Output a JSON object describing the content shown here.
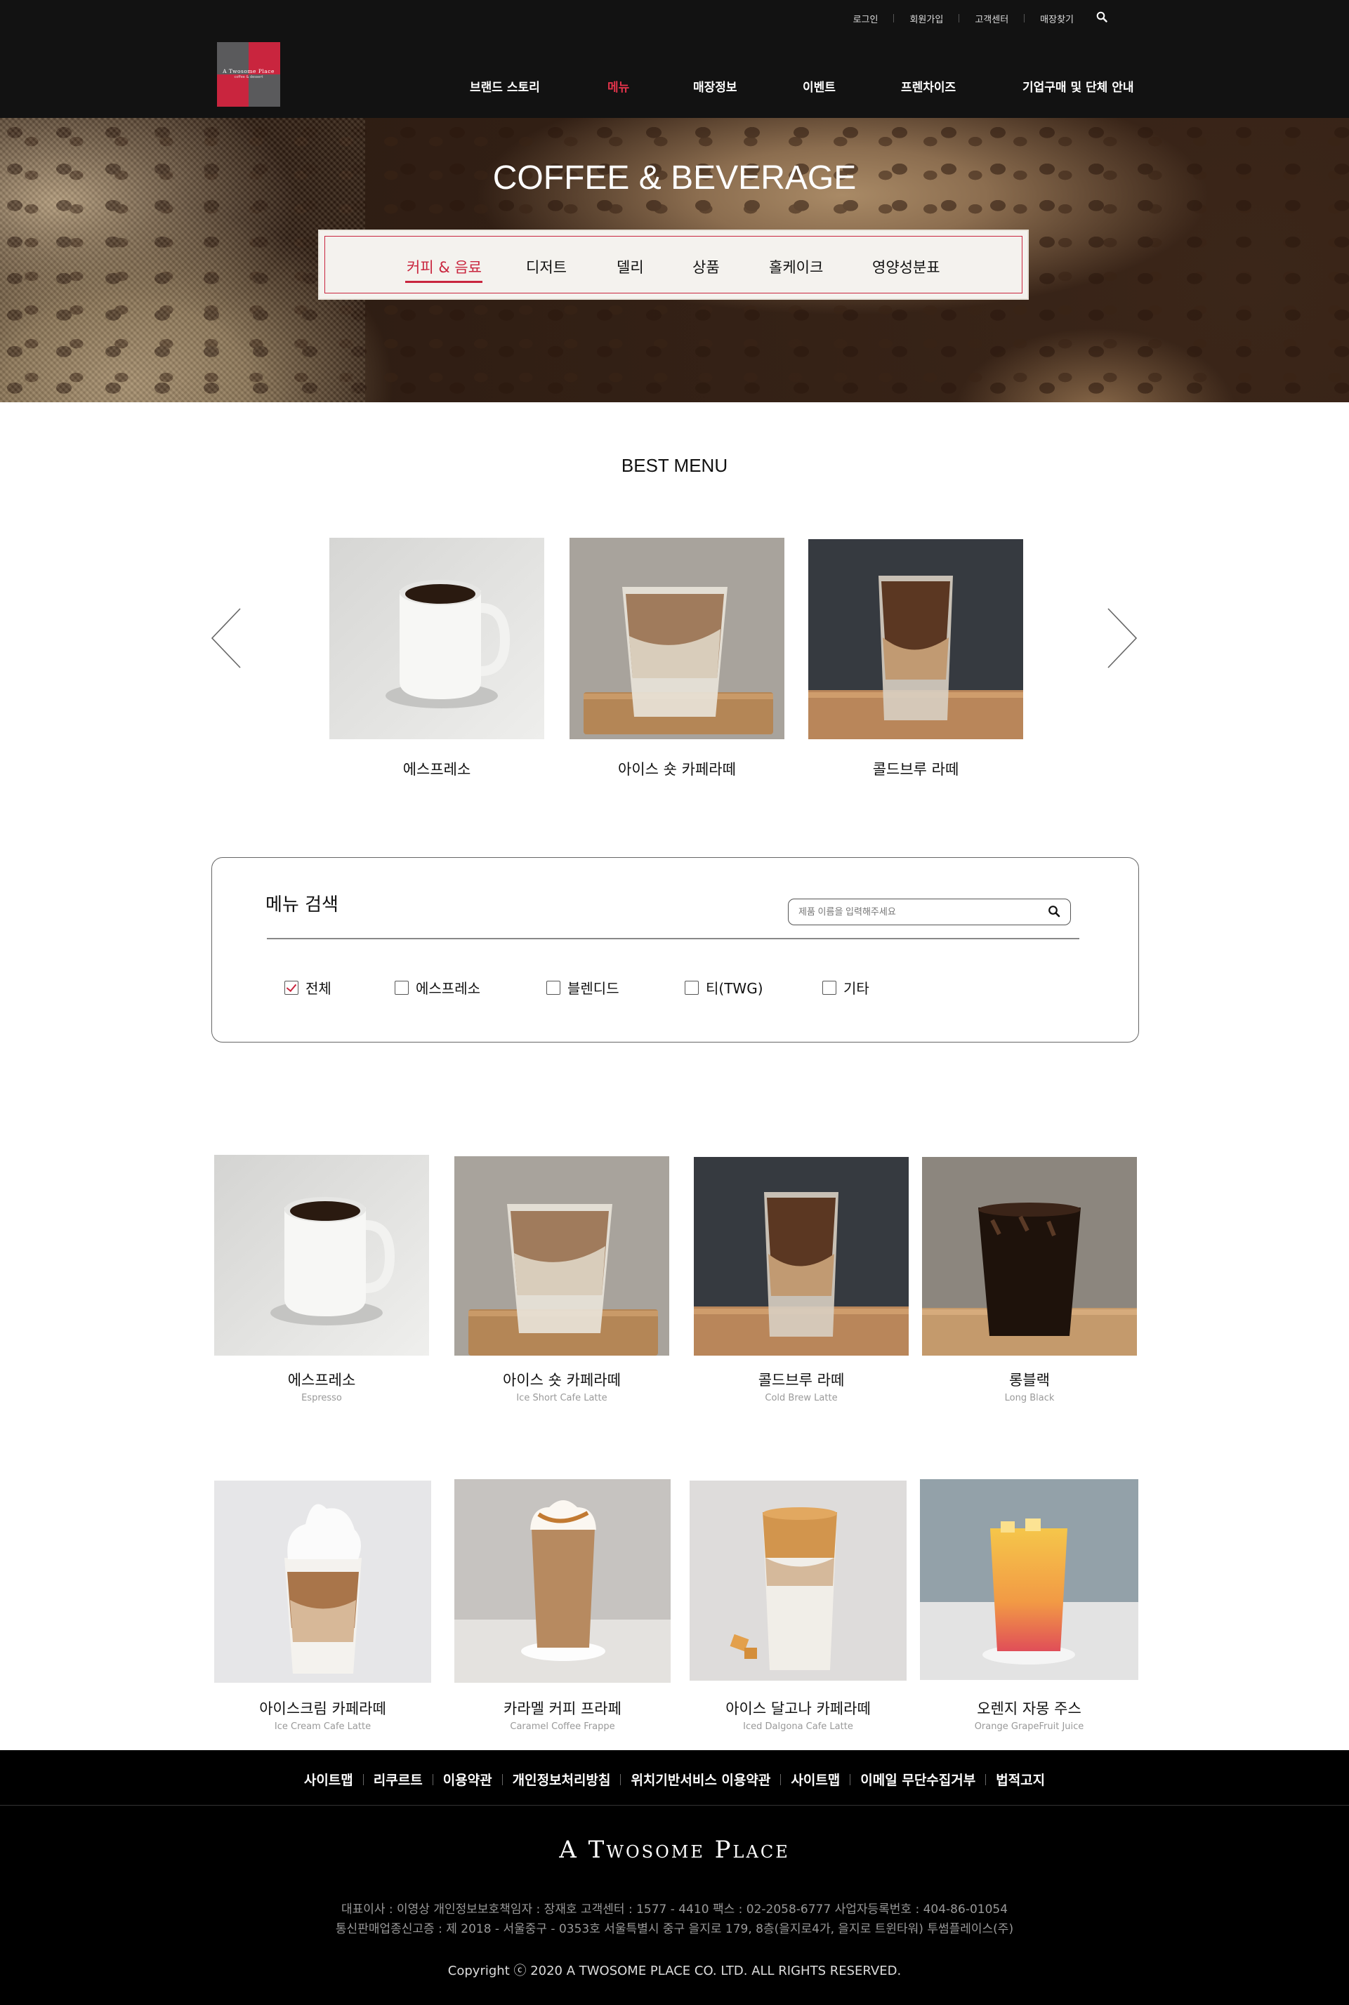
{
  "header": {
    "util_links": [
      "로그인",
      "회원가입",
      "고객센터",
      "매장찾기"
    ],
    "logo_text": "A Twosome Place",
    "logo_subtext": "coffee & dessert",
    "nav": [
      "브랜드 스토리",
      "메뉴",
      "매장정보",
      "이벤트",
      "프렌차이즈",
      "기업구매 및 단체 안내"
    ],
    "nav_active": "메뉴",
    "colors": {
      "bg": "#121212",
      "accent": "#e0334a"
    }
  },
  "hero": {
    "title": "COFFEE & BEVERAGE",
    "categories": [
      "커피 & 음료",
      "디저트",
      "델리",
      "상품",
      "홀케이크",
      "영양성분표"
    ],
    "active_category": "커피 & 음료"
  },
  "best_menu": {
    "title": "BEST MENU",
    "items": [
      "에스프레소",
      "아이스 숏 카페라떼",
      "콜드브루 라떼"
    ],
    "prev_icon": "chevron-left-icon",
    "next_icon": "chevron-right-icon"
  },
  "search": {
    "title": "메뉴 검색",
    "placeholder": "제품 이름을 입력해주세요",
    "filters": [
      {
        "label": "전체",
        "checked": true
      },
      {
        "label": "에스프레소",
        "checked": false
      },
      {
        "label": "블렌디드",
        "checked": false
      },
      {
        "label": "티(TWG)",
        "checked": false
      },
      {
        "label": "기타",
        "checked": false
      }
    ]
  },
  "products": [
    {
      "name": "에스프레소",
      "en": "Espresso"
    },
    {
      "name": "아이스 숏 카페라떼",
      "en": "Ice Short Cafe Latte"
    },
    {
      "name": "콜드브루 라떼",
      "en": "Cold Brew Latte"
    },
    {
      "name": "롱블랙",
      "en": "Long Black"
    },
    {
      "name": "아이스크림 카페라떼",
      "en": "Ice Cream Cafe Latte"
    },
    {
      "name": "카라멜 커피 프라페",
      "en": "Caramel Coffee Frappe"
    },
    {
      "name": "아이스 달고나 카페라떼",
      "en": "Iced Dalgona Cafe Latte"
    },
    {
      "name": "오렌지 자몽 주스",
      "en": "Orange GrapeFruit Juice"
    }
  ],
  "footer": {
    "links": [
      "사이트맵",
      "리쿠르트",
      "이용약관",
      "개인정보처리방침",
      "위치기반서비스 이용약관",
      "사이트맵",
      "이메일 무단수집거부",
      "법적고지"
    ],
    "logo": "A Twosome Place",
    "info_line1": "대표이사 : 이영상    개인정보보호책임자 : 장재호     고객센터 : 1577 - 4410     팩스 : 02-2058-6777     사업자등록번호 : 404-86-01054",
    "info_line2": "통신판매업종신고증 : 제 2018 - 서울중구 - 0353호     서울특별시 중구 을지로 179, 8층(을지로4가, 을지로 트윈타워) 투썸플레이스(주)",
    "copyright": "Copyright ⓒ 2020 A TWOSOME PLACE CO. LTD. ALL RIGHTS RESERVED."
  }
}
